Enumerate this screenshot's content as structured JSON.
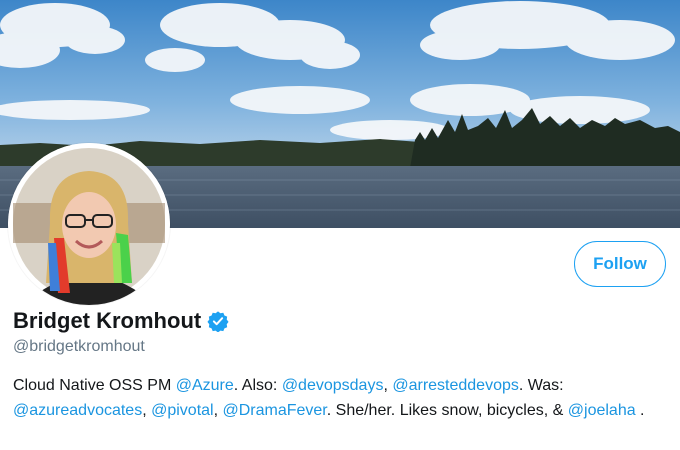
{
  "profile": {
    "display_name": "Bridget Kromhout",
    "handle": "@bridgetkromhout",
    "verified": true,
    "follow_label": "Follow",
    "bio": [
      {
        "type": "text",
        "text": "Cloud Native OSS PM "
      },
      {
        "type": "link",
        "text": "@Azure"
      },
      {
        "type": "text",
        "text": ". Also: "
      },
      {
        "type": "link",
        "text": "@devopsdays"
      },
      {
        "type": "text",
        "text": ", "
      },
      {
        "type": "link",
        "text": "@arresteddevops"
      },
      {
        "type": "text",
        "text": ". Was: "
      },
      {
        "type": "link",
        "text": "@azureadvocates"
      },
      {
        "type": "text",
        "text": ", "
      },
      {
        "type": "link",
        "text": "@pivotal"
      },
      {
        "type": "text",
        "text": ", "
      },
      {
        "type": "link",
        "text": "@DramaFever"
      },
      {
        "type": "text",
        "text": ". She/her. Likes snow, bicycles, & "
      },
      {
        "type": "link",
        "text": "@joelaha"
      },
      {
        "type": "text",
        "text": " ."
      }
    ]
  },
  "colors": {
    "accent": "#1da1f2",
    "link": "#1b95e0",
    "verified": "#1da1f2",
    "handle": "#657786"
  },
  "icons": {
    "verified": "verified-badge-icon"
  }
}
